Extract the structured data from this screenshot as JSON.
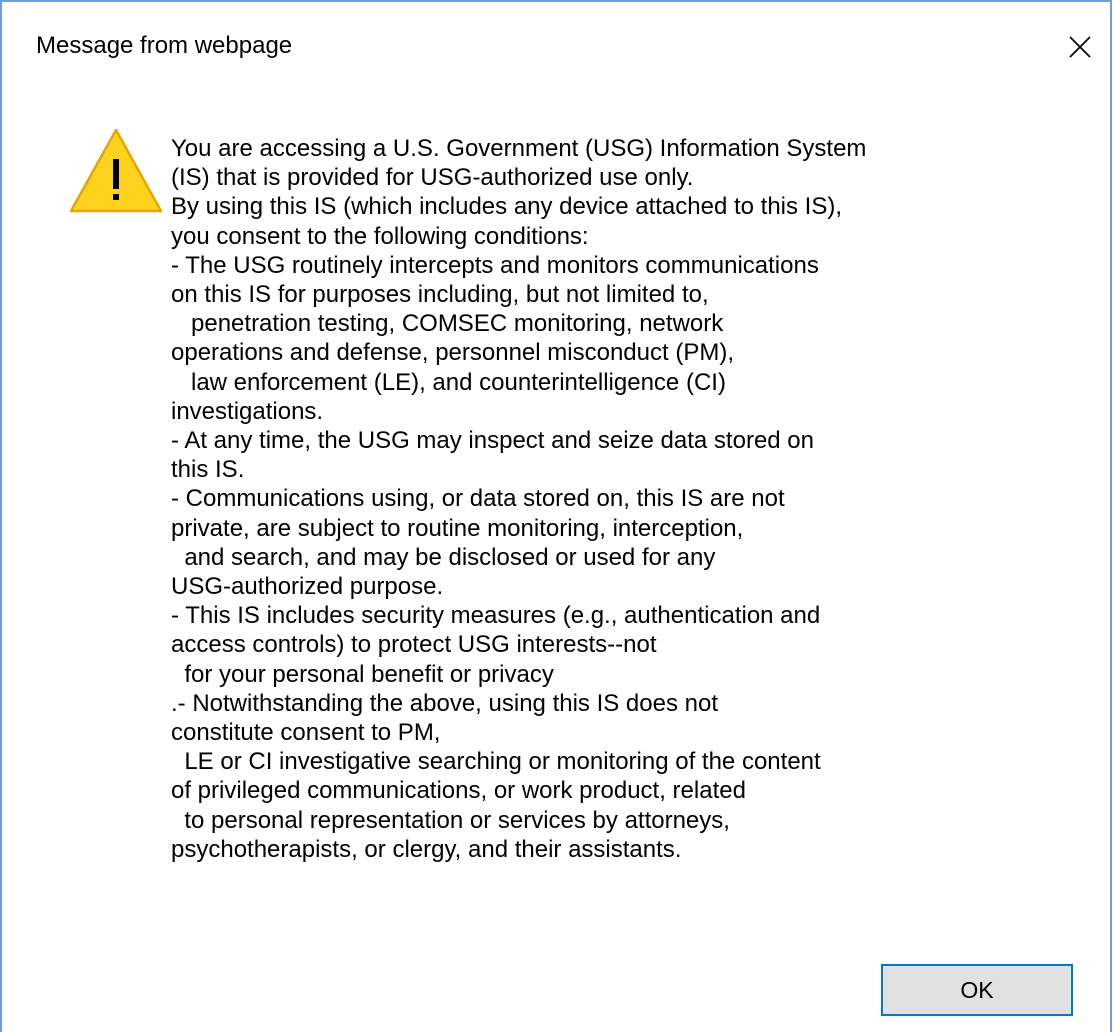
{
  "dialog": {
    "title": "Message from webpage",
    "close_icon": "close-icon",
    "warning_icon": "warning-icon",
    "message_lines": [
      "You are accessing a U.S. Government (USG) Information System",
      "(IS) that is provided for USG-authorized use only.",
      "By using this IS (which includes any device attached to this IS),",
      "you consent to the following conditions:",
      "- The USG routinely intercepts and monitors communications",
      "on this IS for purposes including, but not limited to,",
      "   penetration testing, COMSEC monitoring, network",
      "operations and defense, personnel misconduct (PM),",
      "   law enforcement (LE), and counterintelligence (CI)",
      "investigations.",
      "- At any time, the USG may inspect and seize data stored on",
      "this IS.",
      "- Communications using, or data stored on, this IS are not",
      "private, are subject to routine monitoring, interception,",
      "  and search, and may be disclosed or used for any",
      "USG-authorized purpose.",
      "- This IS includes security measures (e.g., authentication and",
      "access controls) to protect USG interests--not",
      "  for your personal benefit or privacy",
      ".- Notwithstanding the above, using this IS does not",
      "constitute consent to PM,",
      "  LE or CI investigative searching or monitoring of the content",
      "of privileged communications, or work product, related",
      "  to personal representation or services by attorneys,",
      "psychotherapists, or clergy, and their assistants."
    ],
    "ok_label": "OK"
  },
  "colors": {
    "border": "#6d9ee0",
    "ok_border": "#0078d7",
    "ok_background": "#e1e1e1",
    "warning_fill": "#ffd21f",
    "warning_stroke": "#e8a400"
  }
}
